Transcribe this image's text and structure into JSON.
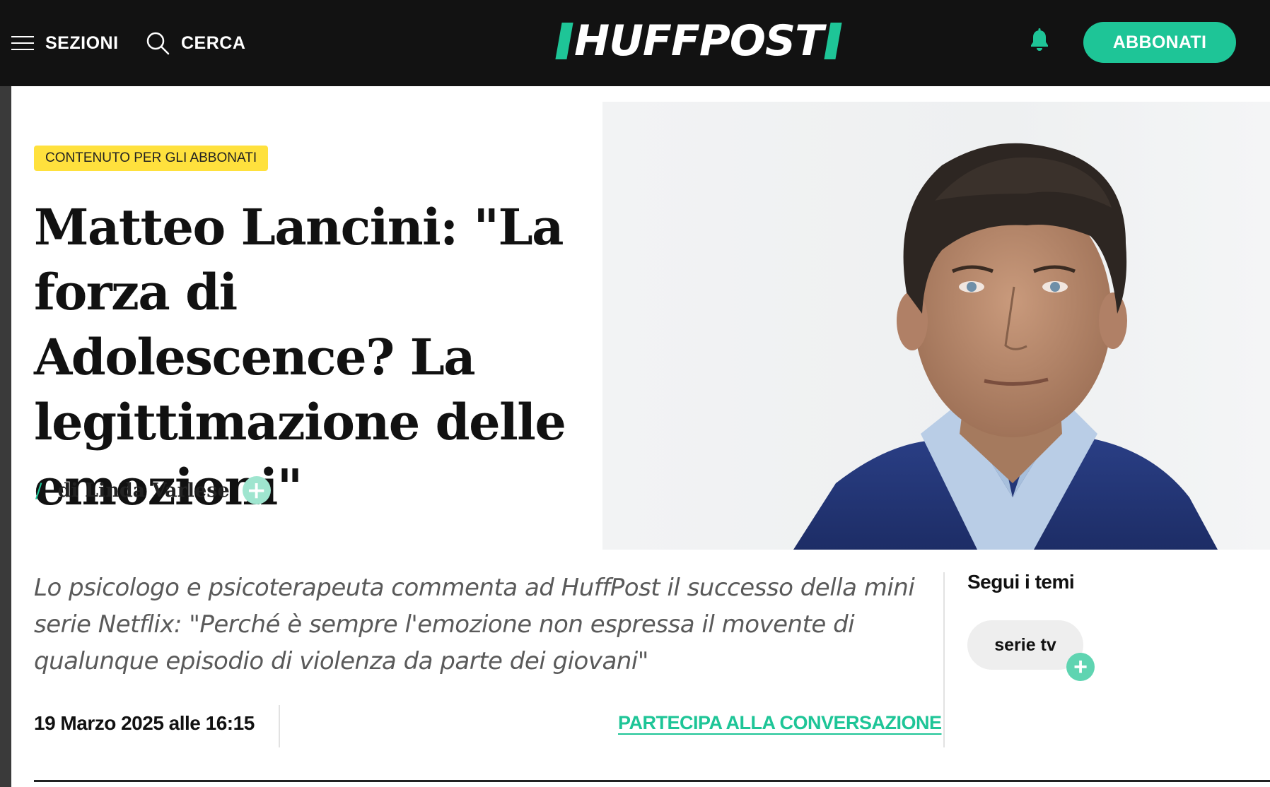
{
  "header": {
    "sections_label": "SEZIONI",
    "search_label": "CERCA",
    "logo_text": "HUFFPOST",
    "subscribe_label": "ABBONATI"
  },
  "article": {
    "badge": "CONTENUTO PER GLI ABBONATI",
    "headline": "Matteo Lancini: \"La forza di Adolescence? La legittimazione delle emozioni\"",
    "byline_slash": "/",
    "byline": "di Linda Varlese",
    "summary": "Lo psicologo e psicoterapeuta commenta ad HuffPost il successo della mini serie Netflix: \"Perché è sempre l'emozione non espressa il movente di qualunque episodio di violenza da parte dei giovani\"",
    "date": "19 Marzo 2025 alle 16:15",
    "join_conversation": "PARTECIPA ALLA CONVERSAZIONE"
  },
  "sidebar": {
    "title": "Segui i temi",
    "tags": [
      {
        "label": "serie tv"
      }
    ]
  },
  "colors": {
    "brand_green": "#1ec597",
    "badge_yellow": "#ffe13d",
    "header_bg": "#121212"
  },
  "icons": {
    "menu": "hamburger-icon",
    "search": "search-icon",
    "notification": "bell-icon",
    "follow": "plus-icon"
  }
}
